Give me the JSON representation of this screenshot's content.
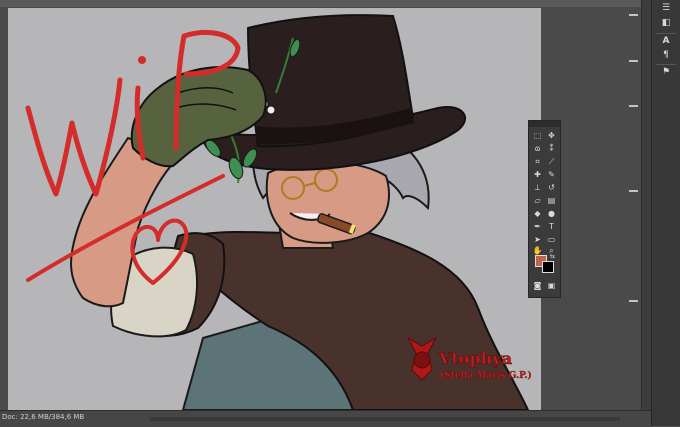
{
  "artwork": {
    "scribble_text": "WIP",
    "watermark": {
      "name": "Vtophya",
      "subtitle": "(Stella Maris G.P.)"
    }
  },
  "status_bar": {
    "doc_info": "Doc: 22,6 MB/384,6 MB"
  },
  "colors": {
    "foreground": "#c0634f",
    "background": "#000000",
    "canvas_backdrop": "#b6b6b8",
    "scribble_red": "#d42b2b",
    "hat": "#2a1e1e",
    "cape": "#4a322c",
    "vest": "#5c7478",
    "glove": "#56633e",
    "skin": "#d69a85",
    "hair": "#a8a8ae"
  },
  "tools": [
    "move-tool",
    "artboard-tool",
    "marquee-tool",
    "lasso-tool",
    "quick-selection-tool",
    "magic-wand-tool",
    "crop-tool",
    "eyedropper-tool",
    "healing-brush-tool",
    "brush-tool",
    "clone-stamp-tool",
    "history-brush-tool",
    "eraser-tool",
    "gradient-tool",
    "blur-tool",
    "dodge-tool",
    "pen-tool",
    "type-tool",
    "path-selection-tool",
    "shape-tool",
    "hand-tool",
    "zoom-tool"
  ],
  "right_dock": [
    "history-icon",
    "properties-icon",
    "character-icon",
    "paragraph-icon",
    "glyphs-icon"
  ]
}
